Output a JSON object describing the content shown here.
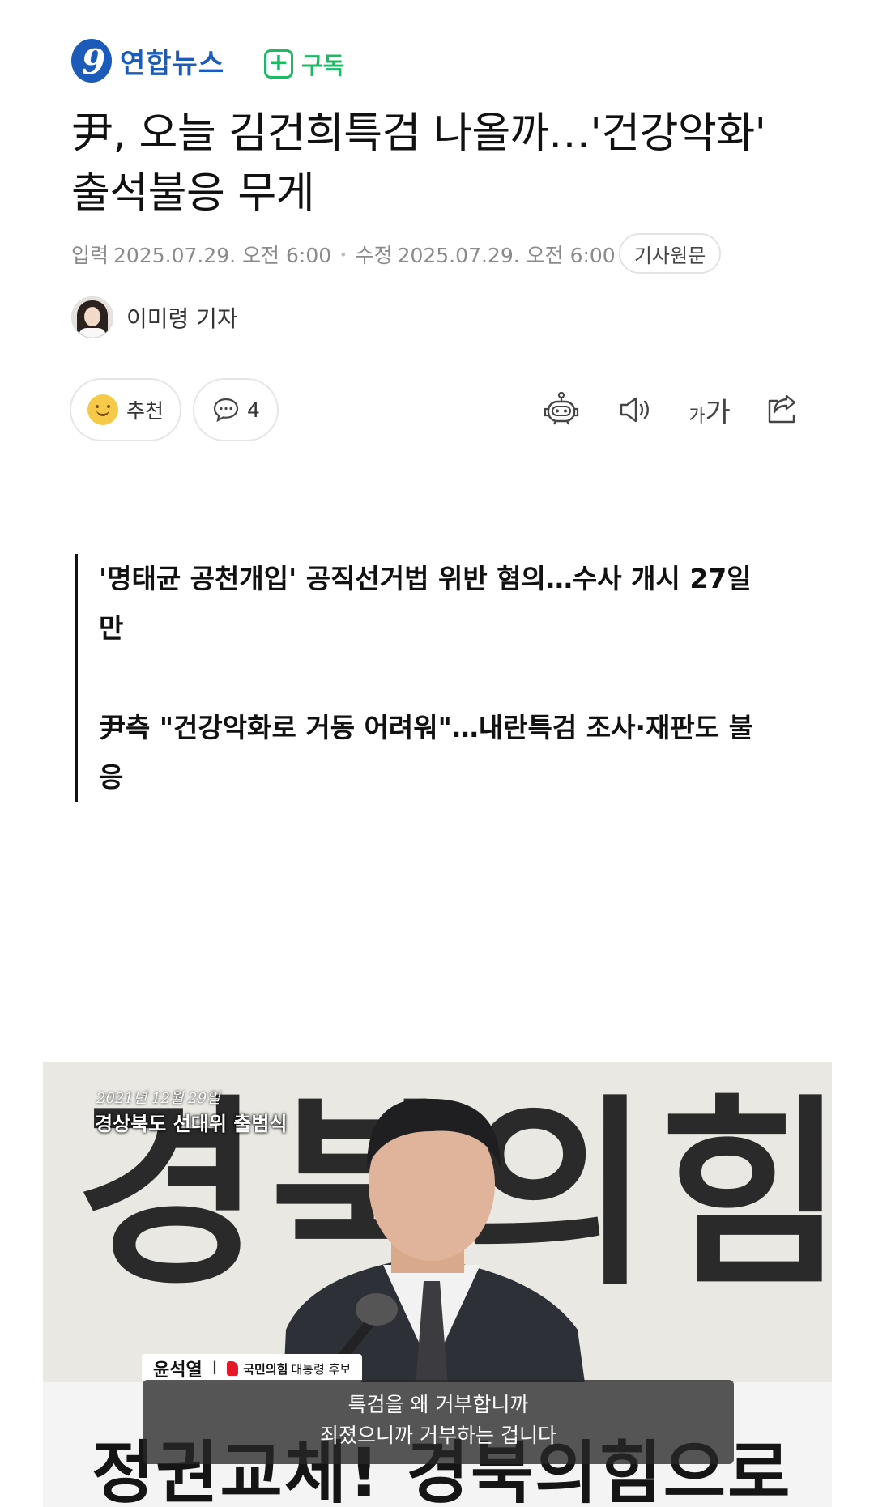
{
  "header": {
    "brand_logo_letter": "9",
    "brand_name": "연합뉴스",
    "subscribe_icon": "+",
    "subscribe_label": "구독"
  },
  "article": {
    "title": "尹, 오늘 김건희특검 나올까…'건강악화' 출석불응 무게",
    "published_label": "입력",
    "published": "2025.07.29. 오전 6:00",
    "modified_label": "수정",
    "modified": "2025.07.29. 오전 6:00",
    "original_button": "기사원문",
    "author": "이미령 기자"
  },
  "actions": {
    "like_label": "추천",
    "comment_count": "4",
    "font_small": "가",
    "font_large": "가",
    "icons": [
      "smile-icon",
      "comment-icon",
      "robot-summary-icon",
      "speaker-icon",
      "font-size-icon",
      "share-icon"
    ]
  },
  "related": [
    "'명태균 공천개입' 공직선거법 위반 혐의…수사 개시 27일만",
    "尹측 \"건강악화로 거동 어려워\"…내란특검 조사·재판도 불응"
  ],
  "photo": {
    "bg_letters": "경북의힘",
    "caption_date": "2021년 12월 29일",
    "caption_event": "경상북도 선대위 출범식",
    "name": "윤석열",
    "name_separator": "I",
    "party": "국민의힘",
    "role": "대통령 후보",
    "subtitle_line1": "특검을 왜 거부합니까",
    "subtitle_line2": "죄졌으니까 거부하는 겁니다",
    "banner_text": "정권교체! 경북의힘으로"
  },
  "colors": {
    "brand_blue": "#1d5bb8",
    "subscribe_green": "#1fb964",
    "meta_gray": "#8a8a8a",
    "party_red": "#e5182b"
  }
}
